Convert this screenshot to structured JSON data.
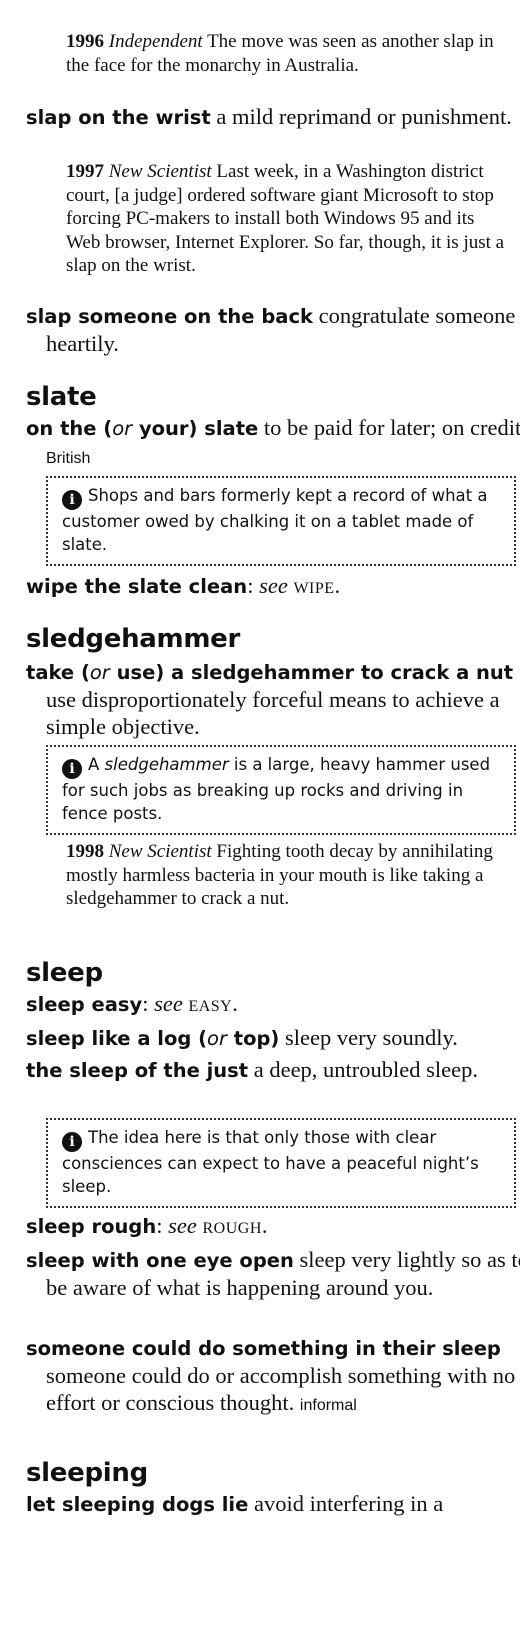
{
  "quotes": {
    "q1": {
      "year": "1996",
      "source": "Independent",
      "text": "The move was seen as another slap in the face for the monarchy in Australia."
    },
    "q2": {
      "year": "1997",
      "source": "New Scientist",
      "text": "Last week, in a Washington district court, [a judge] ordered software giant Microsoft to stop forcing PC-makers to install both Windows 95 and its Web browser, Internet Explorer. So far, though, it is just a slap on the wrist."
    },
    "q3": {
      "year": "1998",
      "source": "New Scientist",
      "text": "Fighting tooth decay by annihilating mostly harmless bacteria in your mouth is like taking a sledgehammer to crack a nut."
    }
  },
  "entries": {
    "slap_wrist": {
      "phrase": "slap on the wrist",
      "def": "a mild reprimand or punishment."
    },
    "slap_back": {
      "phrase": "slap someone on the back",
      "def": "congratulate someone heartily."
    },
    "on_slate": {
      "p1": "on the (",
      "or": "or",
      "p2": " your) slate",
      "def": "to be paid for later; on credit.",
      "region": "British"
    },
    "wipe_slate": {
      "phrase": "wipe the slate clean",
      "see": "see",
      "target": "wipe."
    },
    "sledge_nut": {
      "p1": "take (",
      "or": "or",
      "p2": " use) a sledgehammer to crack a nut",
      "def": "use disproportionately forceful means to achieve a simple objective."
    },
    "sleep_easy": {
      "phrase": "sleep easy",
      "see": "see",
      "target": "easy."
    },
    "sleep_log": {
      "p1": "sleep like a log (",
      "or": "or",
      "p2": " top)",
      "def": "sleep very soundly."
    },
    "sleep_just": {
      "phrase": "the sleep of the just",
      "def": "a deep, untroubled sleep."
    },
    "sleep_rough": {
      "phrase": "sleep rough",
      "see": "see",
      "target": "rough."
    },
    "sleep_eye": {
      "phrase": "sleep with one eye open",
      "def": "sleep very lightly so as to be aware of what is happening around you."
    },
    "in_sleep": {
      "phrase": "someone could do something in their sleep",
      "def": "someone could do or accomplish some­thing with no effort or conscious thought.",
      "region": "informal"
    },
    "dogs_lie": {
      "phrase": "let sleeping dogs lie",
      "def": "avoid interfering in a"
    }
  },
  "headwords": {
    "slate": "slate",
    "sledgehammer": "sledgehammer",
    "sleep": "sleep",
    "sleeping": "sleeping"
  },
  "notes": {
    "n1": {
      "icon": "i",
      "text": "Shops and bars formerly kept a record of what a customer owed by chalking it on a tablet made of slate."
    },
    "n2": {
      "icon": "i",
      "term": "sledgehammer",
      "text": "is a large, heavy hammer used for such jobs as breaking up rocks and driving in fence posts.",
      "pre": "A "
    },
    "n3": {
      "icon": "i",
      "text": "The idea here is that only those with clear consciences can expect to have a peaceful night’s sleep."
    }
  }
}
